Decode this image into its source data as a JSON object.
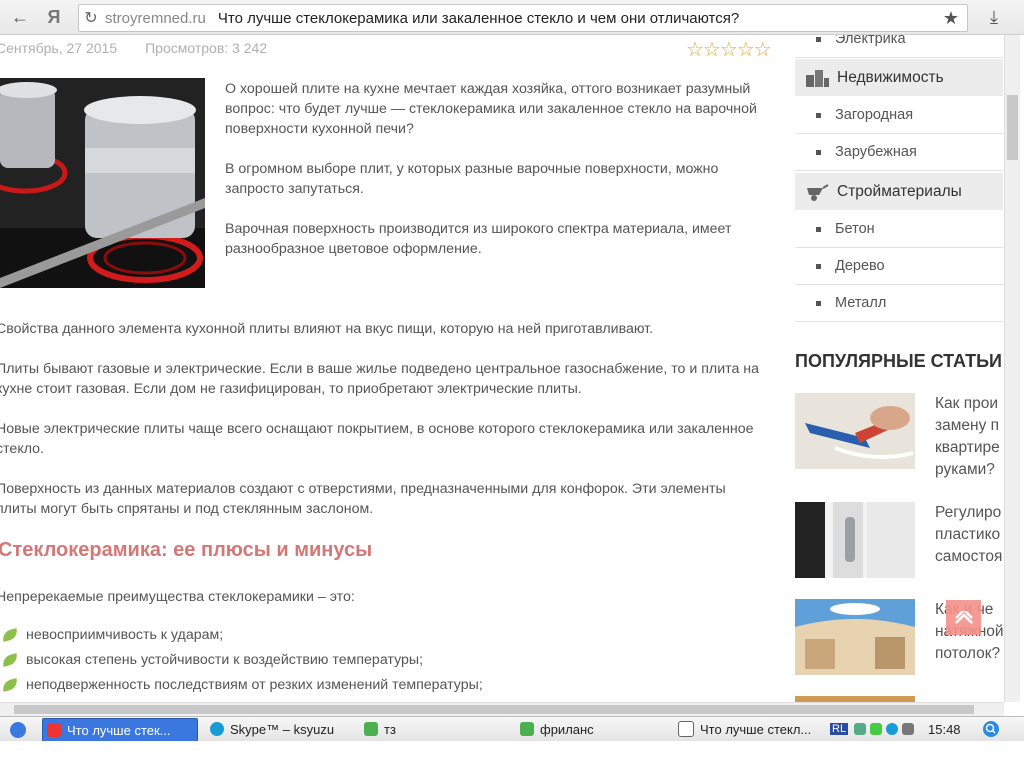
{
  "browser": {
    "host": "stroyremned.ru",
    "title": "Что лучше стеклокерамика или закаленное стекло и чем они отличаются?"
  },
  "article": {
    "date": "Сентябрь, 27 2015",
    "views": "Просмотров: 3 242",
    "intro": [
      "О хорошей плите на кухне мечтает каждая хозяйка, оттого возникает разумный вопрос: что будет лучше — стеклокерамика или закаленное стекло на варочной поверхности кухонной печи?",
      "В огромном выборе плит, у которых разные варочные поверхности, можно запросто запутаться.",
      "Варочная поверхность производится из широкого спектра материала, имеет разнообразное цветовое оформление."
    ],
    "paragraphs": [
      "Свойства данного элемента кухонной плиты влияют на вкус пищи, которую на ней приготавливают.",
      "Плиты бывают газовые и электрические. Если в ваше жилье подведено центральное газоснабжение, то и плита на кухне стоит газовая. Если дом не газифицирован, то приобретают электрические плиты.",
      "Новые электрические плиты чаще всего оснащают покрытием, в основе которого стеклокерамика или закаленное стекло.",
      "Поверхность из данных материалов создают с отверстиями, предназначенными для конфорок. Эти элементы плиты могут быть спрятаны и под стеклянным заслоном."
    ],
    "section_title": "Стеклокерамика: ее плюсы и минусы",
    "section_intro": "Непререкаемые преимущества стеклокерамики – это:",
    "bullets": [
      "невосприимчивость к ударам;",
      "высокая степень устойчивости к воздействию температуры;",
      "неподверженность последствиям от резких изменений температуры;"
    ]
  },
  "sidebar": {
    "items": [
      {
        "type": "sub",
        "label": "Электрика"
      },
      {
        "type": "cat",
        "label": "Недвижимость"
      },
      {
        "type": "sub",
        "label": "Загородная"
      },
      {
        "type": "sub",
        "label": "Зарубежная"
      },
      {
        "type": "cat",
        "label": "Стройматериалы"
      },
      {
        "type": "sub",
        "label": "Бетон"
      },
      {
        "type": "sub",
        "label": "Дерево"
      },
      {
        "type": "sub",
        "label": "Металл"
      }
    ],
    "popular_title": "ПОПУЛЯРНЫЕ СТАТЬИ",
    "popular": [
      {
        "lines": [
          "Как прои",
          "замену п",
          "квартире",
          "руками?"
        ]
      },
      {
        "lines": [
          "Регулиро",
          "пластико",
          "самостоя"
        ]
      },
      {
        "lines": [
          "Как и че",
          "натяжной",
          "потолок?"
        ]
      }
    ]
  },
  "taskbar": {
    "tasks": [
      "Что лучше стек...",
      "Skype™ – ksyuzu",
      "тз",
      "фриланс",
      "Что лучше стекл..."
    ],
    "tray_lang": "RL",
    "clock": "15:48"
  }
}
